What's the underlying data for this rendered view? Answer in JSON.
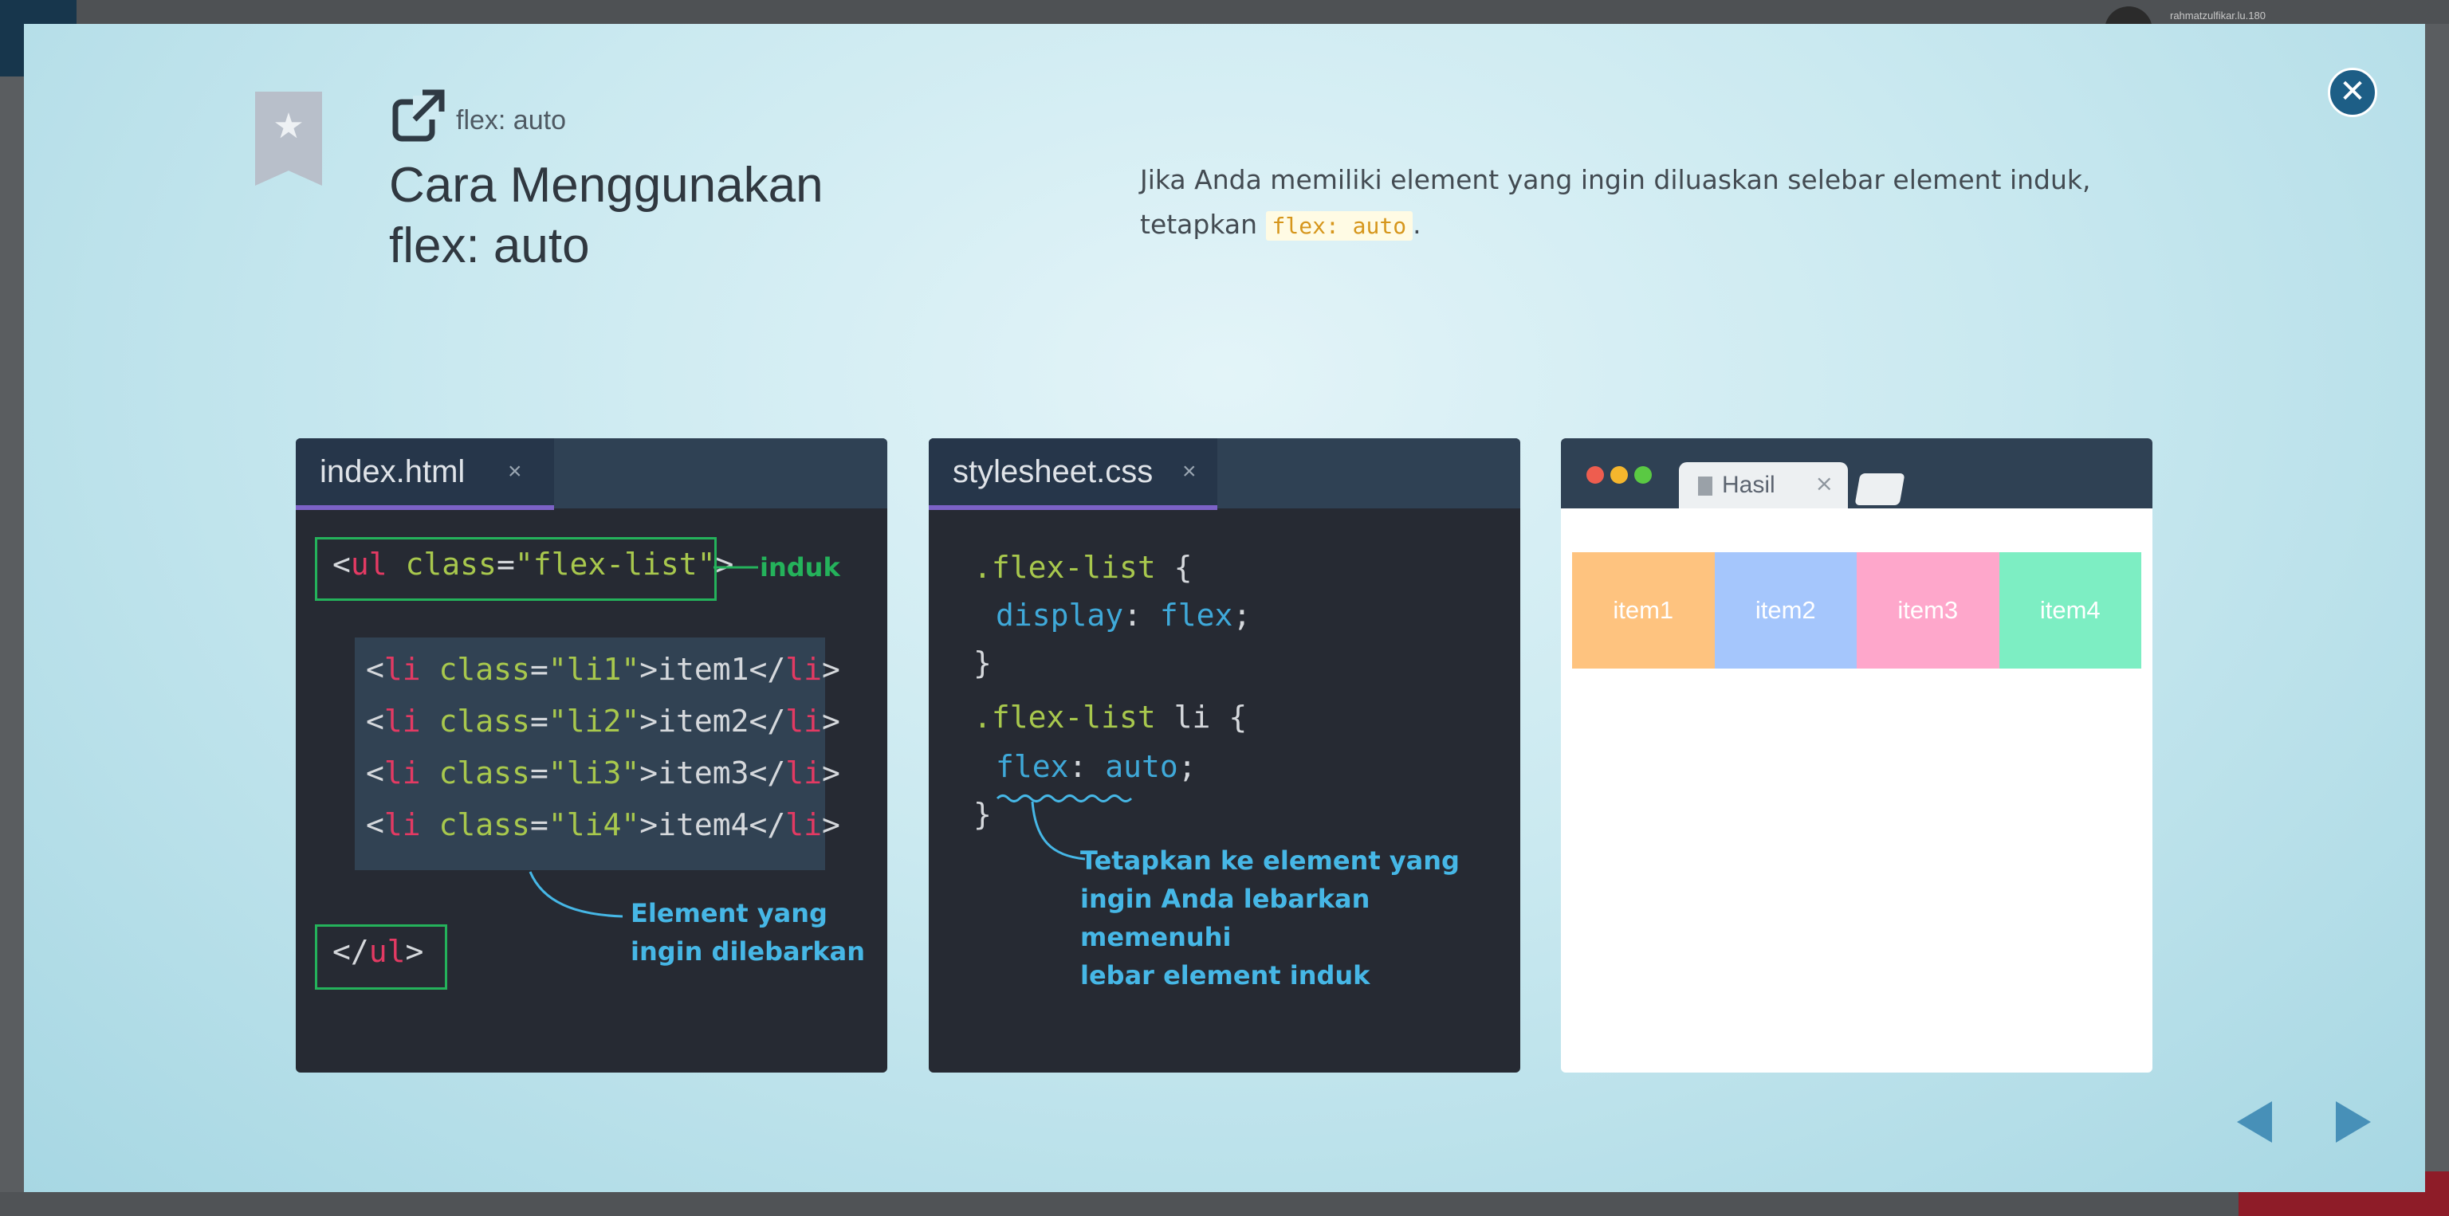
{
  "background": {
    "username": "rahmatzulfikar.lu.180"
  },
  "lesson": {
    "subtitle": "flex: auto",
    "title_line1": "Cara Menggunakan",
    "title_line2": "flex: auto",
    "desc_part1": "Jika Anda memiliki element yang ingin diluaskan selebar element induk,",
    "desc_part2": "tetapkan",
    "desc_code": "flex: auto",
    "desc_end": ".",
    "close_icon": "close-icon"
  },
  "html_panel": {
    "tab_label": "index.html",
    "close_glyph": "×",
    "note_induk": "induk",
    "note_line1": "Element yang",
    "note_line2": "ingin dilebarkan",
    "li_items": [
      {
        "cls": "li1",
        "text": "item1"
      },
      {
        "cls": "li2",
        "text": "item2"
      },
      {
        "cls": "li3",
        "text": "item3"
      },
      {
        "cls": "li4",
        "text": "item4"
      }
    ]
  },
  "css_panel": {
    "tab_label": "stylesheet.css",
    "close_glyph": "×",
    "selector1": ".flex-list",
    "prop1": "display",
    "val1": "flex",
    "selector2": ".flex-list",
    "selector2_el": "li",
    "prop2": "flex",
    "val2": "auto",
    "note_line1": "Tetapkan ke element yang",
    "note_line2": "ingin Anda lebarkan memenuhi",
    "note_line3": "lebar element induk"
  },
  "result_panel": {
    "tab_label": "Hasil",
    "close_glyph": "×",
    "items": [
      {
        "label": "item1",
        "color": "#fec37f"
      },
      {
        "label": "item2",
        "color": "#a5c6fc"
      },
      {
        "label": "item3",
        "color": "#fea7cb"
      },
      {
        "label": "item4",
        "color": "#7deec3"
      }
    ]
  },
  "nav": {
    "prev_icon": "arrow-left-icon",
    "next_icon": "arrow-right-icon"
  }
}
